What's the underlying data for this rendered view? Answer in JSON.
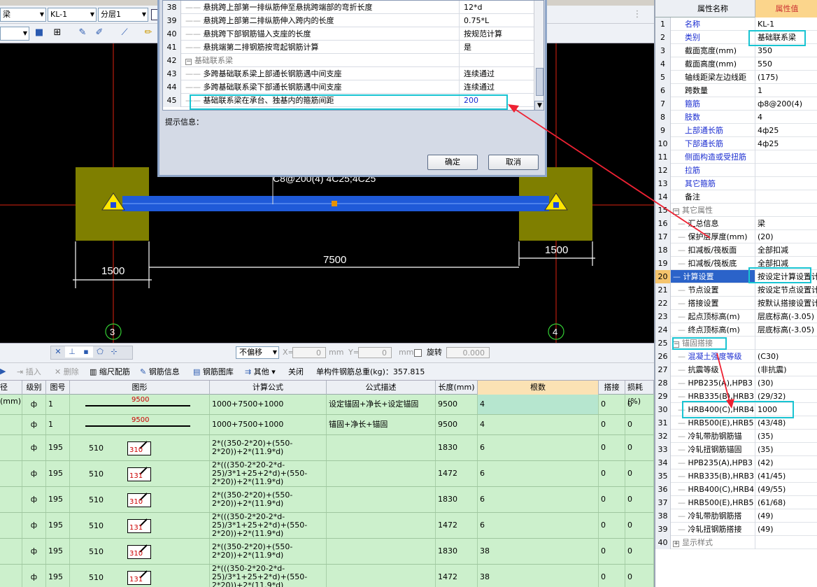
{
  "toolbar": {
    "combo_type": "梁",
    "combo_name": "KL-1",
    "combo_floor": "分层1"
  },
  "dialog": {
    "rows": [
      {
        "num": "38",
        "name": "悬挑跨上部第一排纵筋伸至悬挑跨端部的弯折长度",
        "value": "12*d"
      },
      {
        "num": "39",
        "name": "悬挑跨上部第二排纵筋伸入跨内的长度",
        "value": "0.75*L"
      },
      {
        "num": "40",
        "name": "悬挑跨下部钢筋锚入支座的长度",
        "value": "按规范计算"
      },
      {
        "num": "41",
        "name": "悬挑端第二排钢筋按弯起钢筋计算",
        "value": "是"
      },
      {
        "num": "42",
        "name": "基础联系梁",
        "value": ""
      },
      {
        "num": "43",
        "name": "多跨基础联系梁上部通长钢筋遇中间支座",
        "value": "连续通过"
      },
      {
        "num": "44",
        "name": "多跨基础联系梁下部通长钢筋遇中间支座",
        "value": "连续通过"
      },
      {
        "num": "45",
        "name": "基础联系梁在承台、独基内的箍筋间距",
        "value": "200"
      }
    ],
    "hint_label": "提示信息：",
    "ok_label": "确定",
    "cancel_label": "取消"
  },
  "canvas": {
    "beam_label": "C8@200(4) 4C25;4C25",
    "dim_left": "1500",
    "dim_mid": "7500",
    "dim_right": "1500",
    "axis_left": "3",
    "axis_right": "4"
  },
  "snap_bar": {
    "move_mode": "不偏移",
    "x_label": "X=",
    "x_value": "0",
    "y_label": "Y=",
    "y_value": "0",
    "unit": "mm",
    "rotate_label": "旋转",
    "rotate_value": "0.000"
  },
  "rebar_toolbar": {
    "insert": "插入",
    "delete": "删除",
    "scale": "缩尺配筋",
    "info": "钢筋信息",
    "library": "钢筋图库",
    "other": "其他",
    "close": "关闭",
    "total": "单构件钢筋总重(kg)：357.815"
  },
  "table": {
    "headers": [
      "径(mm)",
      "级别",
      "图号",
      "图形",
      "计算公式",
      "公式描述",
      "长度(mm)",
      "根数",
      "搭接",
      "损耗(%)"
    ],
    "rows": [
      {
        "grade": "ф",
        "fig": "1",
        "shape_val": "9500",
        "shape_left": "",
        "formula": "1000+7500+1000",
        "desc": "设定锚固+净长+设定锚固",
        "length": "9500",
        "count": "4",
        "lap": "0",
        "loss": "0"
      },
      {
        "grade": "ф",
        "fig": "1",
        "shape_val": "9500",
        "shape_left": "",
        "formula": "1000+7500+1000",
        "desc": "锚固+净长+锚固",
        "length": "9500",
        "count": "4",
        "lap": "0",
        "loss": "0"
      },
      {
        "grade": "ф",
        "fig": "195",
        "shape_val": "310",
        "shape_left": "510",
        "formula": "2*((350-2*20)+(550-2*20))+2*(11.9*d)",
        "desc": "",
        "length": "1830",
        "count": "6",
        "lap": "0",
        "loss": "0"
      },
      {
        "grade": "ф",
        "fig": "195",
        "shape_val": "131",
        "shape_left": "510",
        "formula": "2*(((350-2*20-2*d-25)/3*1+25+2*d)+(550-2*20))+2*(11.9*d)",
        "desc": "",
        "length": "1472",
        "count": "6",
        "lap": "0",
        "loss": "0"
      },
      {
        "grade": "ф",
        "fig": "195",
        "shape_val": "310",
        "shape_left": "510",
        "formula": "2*((350-2*20)+(550-2*20))+2*(11.9*d)",
        "desc": "",
        "length": "1830",
        "count": "6",
        "lap": "0",
        "loss": "0"
      },
      {
        "grade": "ф",
        "fig": "195",
        "shape_val": "131",
        "shape_left": "510",
        "formula": "2*(((350-2*20-2*d-25)/3*1+25+2*d)+(550-2*20))+2*(11.9*d)",
        "desc": "",
        "length": "1472",
        "count": "6",
        "lap": "0",
        "loss": "0"
      },
      {
        "grade": "ф",
        "fig": "195",
        "shape_val": "310",
        "shape_left": "510",
        "formula": "2*((350-2*20)+(550-2*20))+2*(11.9*d)",
        "desc": "",
        "length": "1830",
        "count": "38",
        "lap": "0",
        "loss": "0"
      },
      {
        "grade": "ф",
        "fig": "195",
        "shape_val": "131",
        "shape_left": "510",
        "formula": "2*(((350-2*20-2*d-25)/3*1+25+2*d)+(550-2*20))+2*(11.9*d)",
        "desc": "",
        "length": "1472",
        "count": "38",
        "lap": "0",
        "loss": "0"
      }
    ]
  },
  "props": {
    "header_name": "属性名称",
    "header_value": "属性值",
    "rows": [
      {
        "num": "1",
        "name": "名称",
        "value": "KL-1",
        "style": "blue"
      },
      {
        "num": "2",
        "name": "类别",
        "value": "基础联系梁",
        "style": "blue"
      },
      {
        "num": "3",
        "name": "截面宽度(mm)",
        "value": "350",
        "style": ""
      },
      {
        "num": "4",
        "name": "截面高度(mm)",
        "value": "550",
        "style": ""
      },
      {
        "num": "5",
        "name": "轴线距梁左边线距",
        "value": "(175)",
        "style": ""
      },
      {
        "num": "6",
        "name": "跨数量",
        "value": "1",
        "style": ""
      },
      {
        "num": "7",
        "name": "箍筋",
        "value": "ф8@200(4)",
        "style": "blue"
      },
      {
        "num": "8",
        "name": "肢数",
        "value": "4",
        "style": "blue"
      },
      {
        "num": "9",
        "name": "上部通长筋",
        "value": "4ф25",
        "style": "blue"
      },
      {
        "num": "10",
        "name": "下部通长筋",
        "value": "4ф25",
        "style": "blue"
      },
      {
        "num": "11",
        "name": "侧面构造或受扭筋",
        "value": "",
        "style": "blue"
      },
      {
        "num": "12",
        "name": "拉筋",
        "value": "",
        "style": "blue"
      },
      {
        "num": "13",
        "name": "其它箍筋",
        "value": "",
        "style": "blue"
      },
      {
        "num": "14",
        "name": "备注",
        "value": "",
        "style": ""
      },
      {
        "num": "15",
        "name": "其它属性",
        "value": "",
        "style": "group"
      },
      {
        "num": "16",
        "name": "汇总信息",
        "value": "梁",
        "style": "child"
      },
      {
        "num": "17",
        "name": "保护层厚度(mm)",
        "value": "(20)",
        "style": "child"
      },
      {
        "num": "18",
        "name": "扣减板/筏板面",
        "value": "全部扣减",
        "style": "child"
      },
      {
        "num": "19",
        "name": "扣减板/筏板底",
        "value": "全部扣减",
        "style": "child"
      },
      {
        "num": "20",
        "name": "计算设置",
        "value": "按设定计算设置计",
        "style": "selected"
      },
      {
        "num": "21",
        "name": "节点设置",
        "value": "按设定节点设置计",
        "style": "child"
      },
      {
        "num": "22",
        "name": "搭接设置",
        "value": "按默认搭接设置计",
        "style": "child"
      },
      {
        "num": "23",
        "name": "起点顶标高(m)",
        "value": "层底标高(-3.05)",
        "style": "child"
      },
      {
        "num": "24",
        "name": "终点顶标高(m)",
        "value": "层底标高(-3.05)",
        "style": "child"
      },
      {
        "num": "25",
        "name": "锚固搭接",
        "value": "",
        "style": "group"
      },
      {
        "num": "26",
        "name": "混凝土强度等级",
        "value": "(C30)",
        "style": "childblue"
      },
      {
        "num": "27",
        "name": "抗震等级",
        "value": "(非抗震)",
        "style": "child"
      },
      {
        "num": "28",
        "name": "HPB235(A),HPB3",
        "value": "(30)",
        "style": "child"
      },
      {
        "num": "29",
        "name": "HRB335(B),HRB3",
        "value": "(29/32)",
        "style": "child"
      },
      {
        "num": "30",
        "name": "HRB400(C),HRB4",
        "value": "1000",
        "style": "child"
      },
      {
        "num": "31",
        "name": "HRB500(E),HRB5",
        "value": "(43/48)",
        "style": "child"
      },
      {
        "num": "32",
        "name": "冷轧带肋钢筋锚",
        "value": "(35)",
        "style": "child"
      },
      {
        "num": "33",
        "name": "冷轧扭钢筋锚固",
        "value": "(35)",
        "style": "child"
      },
      {
        "num": "34",
        "name": "HPB235(A),HPB3",
        "value": "(42)",
        "style": "child"
      },
      {
        "num": "35",
        "name": "HRB335(B),HRB3",
        "value": "(41/45)",
        "style": "child"
      },
      {
        "num": "36",
        "name": "HRB400(C),HRB4",
        "value": "(49/55)",
        "style": "child"
      },
      {
        "num": "37",
        "name": "HRB500(E),HRB5",
        "value": "(61/68)",
        "style": "child"
      },
      {
        "num": "38",
        "name": "冷轧带肋钢筋搭",
        "value": "(49)",
        "style": "child"
      },
      {
        "num": "39",
        "name": "冷轧扭钢筋搭接",
        "value": "(49)",
        "style": "child"
      },
      {
        "num": "40",
        "name": "显示样式",
        "value": "",
        "style": "groupplus"
      }
    ]
  }
}
